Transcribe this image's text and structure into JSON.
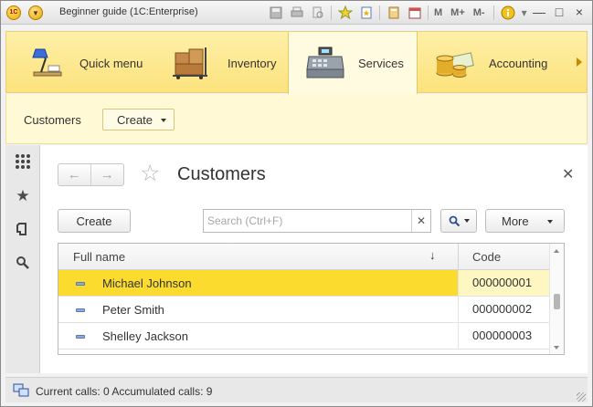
{
  "window": {
    "title": "Beginner guide  (1C:Enterprise)",
    "logo_text": "1C",
    "toolbar_icons": [
      "save-icon",
      "print-icon",
      "print-preview-icon",
      "add-to-favorites-icon",
      "bookmark-icon",
      "calculator-icon",
      "calendar-icon"
    ],
    "memory_labels": {
      "m": "M",
      "mplus": "M+",
      "mminus": "M-"
    },
    "controls": {
      "minimize": "—",
      "restore": "□",
      "close": "×"
    }
  },
  "sections": [
    {
      "label": "Quick menu",
      "icon": "desk-lamp-icon",
      "active": false
    },
    {
      "label": "Inventory",
      "icon": "boxes-cart-icon",
      "active": false
    },
    {
      "label": "Services",
      "icon": "cash-register-icon",
      "active": true
    },
    {
      "label": "Accounting",
      "icon": "coins-icon",
      "active": false
    }
  ],
  "command_bar": {
    "link": "Customers",
    "create_label": "Create"
  },
  "left_toolbar": [
    "function-menu-icon",
    "favorites-star-icon",
    "history-icon",
    "search-icon"
  ],
  "form": {
    "title": "Customers",
    "create_label": "Create",
    "search_placeholder": "Search (Ctrl+F)",
    "more_label": "More",
    "table": {
      "columns": {
        "name": "Full name",
        "code": "Code"
      },
      "sort_indicator": "↓",
      "rows": [
        {
          "name": "Michael Johnson",
          "code": "000000001",
          "selected": true
        },
        {
          "name": "Peter Smith",
          "code": "000000002",
          "selected": false
        },
        {
          "name": "Shelley Jackson",
          "code": "000000003",
          "selected": false
        }
      ]
    }
  },
  "status": {
    "text": "Current calls: 0   Accumulated calls: 9"
  },
  "colors": {
    "sections_bg": "#fbe27c",
    "selected_row": "#fbdc2e"
  }
}
